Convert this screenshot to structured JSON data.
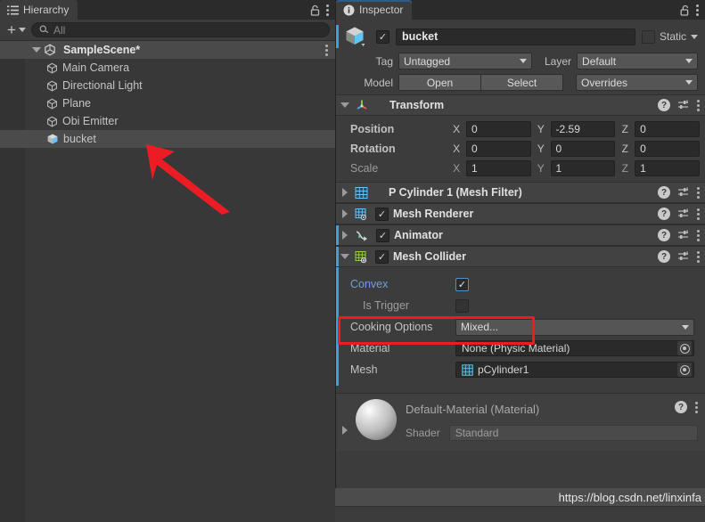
{
  "hierarchy": {
    "tab_label": "Hierarchy",
    "tab_icon": "hierarchy-icon",
    "lock_icon": "lock-icon",
    "menu_icon": "kebab-menu-icon",
    "toolbar": {
      "add_label": "+",
      "search_placeholder": "All",
      "search_value": "",
      "search_icon": "search-icon"
    },
    "scene": {
      "name": "SampleScene*",
      "icon": "unity-scene-icon",
      "expanded": true
    },
    "items": [
      {
        "label": "Main Camera",
        "icon": "gameobject-icon",
        "selected": false
      },
      {
        "label": "Directional Light",
        "icon": "gameobject-icon",
        "selected": false
      },
      {
        "label": "Plane",
        "icon": "gameobject-icon",
        "selected": false
      },
      {
        "label": "Obi Emitter",
        "icon": "gameobject-icon",
        "selected": false
      },
      {
        "label": "bucket",
        "icon": "prefab-icon",
        "selected": true
      }
    ]
  },
  "inspector": {
    "tab_label": "Inspector",
    "tab_icon": "info-icon",
    "lock_icon": "lock-icon",
    "menu_icon": "kebab-menu-icon",
    "header": {
      "object_icon": "prefab-icon",
      "enabled": true,
      "name": "bucket",
      "static_label": "Static",
      "static_checked": false,
      "tag_label": "Tag",
      "tag_value": "Untagged",
      "layer_label": "Layer",
      "layer_value": "Default",
      "model_label": "Model",
      "open_label": "Open",
      "select_label": "Select",
      "overrides_label": "Overrides"
    },
    "transform": {
      "title": "Transform",
      "icon": "transform-axis-icon",
      "expanded": true,
      "rows": [
        {
          "name": "Position",
          "x": "0",
          "y": "-2.59",
          "z": "0",
          "dim": false
        },
        {
          "name": "Rotation",
          "x": "0",
          "y": "0",
          "z": "0",
          "dim": false
        },
        {
          "name": "Scale",
          "x": "1",
          "y": "1",
          "z": "1",
          "dim": true
        }
      ],
      "axis_labels": [
        "X",
        "Y",
        "Z"
      ]
    },
    "components": [
      {
        "title": "P Cylinder 1 (Mesh Filter)",
        "icon": "mesh-filter-icon",
        "has_checkbox": false,
        "enabled": false,
        "expanded": false,
        "blue_edge": false
      },
      {
        "title": "Mesh Renderer",
        "icon": "mesh-renderer-icon",
        "has_checkbox": true,
        "enabled": true,
        "expanded": false,
        "blue_edge": false
      },
      {
        "title": "Animator",
        "icon": "animator-icon",
        "has_checkbox": true,
        "enabled": true,
        "expanded": false,
        "blue_edge": true
      },
      {
        "title": "Mesh Collider",
        "icon": "mesh-collider-icon",
        "has_checkbox": true,
        "enabled": true,
        "expanded": true,
        "blue_edge": true
      }
    ],
    "mesh_collider_props": {
      "convex": {
        "label": "Convex",
        "checked": true,
        "highlighted": true
      },
      "is_trigger": {
        "label": "Is Trigger",
        "checked": false
      },
      "cooking_options": {
        "label": "Cooking Options",
        "value": "Mixed..."
      },
      "material": {
        "label": "Material",
        "value": "None (Physic Material)",
        "picker_icon": "object-picker-icon"
      },
      "mesh": {
        "label": "Mesh",
        "value": "pCylinder1",
        "icon": "mesh-filter-icon",
        "picker_icon": "object-picker-icon"
      }
    },
    "material_preview": {
      "title": "Default-Material (Material)",
      "preview_icon": "material-sphere-preview",
      "shader_label": "Shader",
      "shader_value": "Standard",
      "help_icon": "help-icon",
      "menu_icon": "kebab-menu-icon",
      "expanded": false
    },
    "common_icons": {
      "help_icon": "help-icon",
      "preset_icon": "preset-icon",
      "menu_icon": "kebab-menu-icon"
    }
  },
  "annotations": {
    "arrow": {
      "name": "red-arrow-pointer",
      "color": "#eb1c24",
      "points_to": "bucket"
    },
    "highlight_box": {
      "name": "convex-highlight-box",
      "color": "#f01b1b",
      "targets": "Convex"
    }
  },
  "watermark": {
    "text": "https://blog.csdn.net/linxinfa"
  },
  "colors": {
    "accent_blue": "#3d9fe0",
    "tab_active": "#2c5d87",
    "panel_bg": "#383838",
    "inspector_bg": "#3c3c3c",
    "component_header": "#424242",
    "field_bg": "#2a2a2a",
    "highlight_red": "#f01b1b",
    "convex_text_blue": "#6f9ede"
  }
}
